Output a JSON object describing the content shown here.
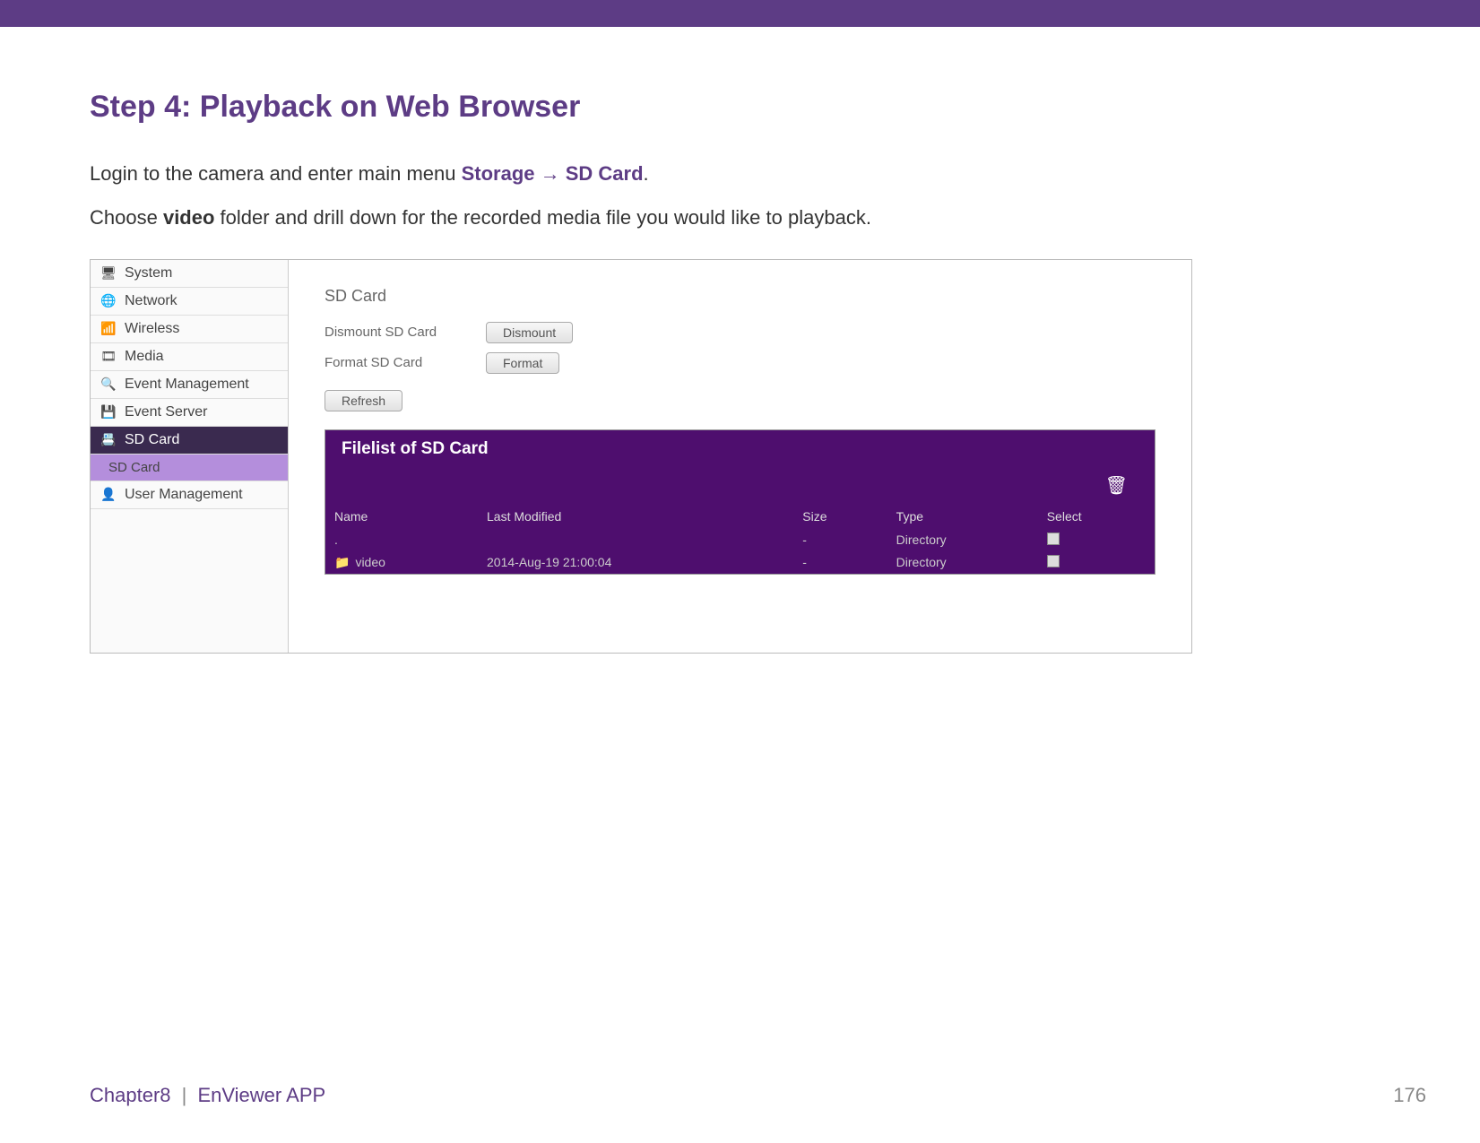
{
  "heading": "Step 4: Playback on Web Browser",
  "para1_a": "Login to the camera and enter main menu ",
  "para1_link1": "Storage",
  "para1_arrow": " → ",
  "para1_link2": "SD Card",
  "para1_end": ".",
  "para2_a": "Choose ",
  "para2_bold": "video",
  "para2_b": " folder and drill down for the recorded media file you would like to playback.",
  "nav": {
    "system": "System",
    "network": "Network",
    "wireless": "Wireless",
    "media": "Media",
    "event_mgmt": "Event Management",
    "event_server": "Event Server",
    "sd_card": "SD Card",
    "sd_card_sub": "SD Card",
    "user_mgmt": "User Management"
  },
  "panel": {
    "title": "SD Card",
    "dismount_label": "Dismount SD Card",
    "dismount_btn": "Dismount",
    "format_label": "Format SD Card",
    "format_btn": "Format",
    "refresh_btn": "Refresh"
  },
  "filelist": {
    "title": "Filelist of SD Card",
    "cols": {
      "name": "Name",
      "last_modified": "Last Modified",
      "size": "Size",
      "type": "Type",
      "select": "Select"
    },
    "rows": [
      {
        "name": ".",
        "last_modified": "",
        "size": "-",
        "type": "Directory"
      },
      {
        "name": "video",
        "last_modified": "2014-Aug-19 21:00:04",
        "size": "-",
        "type": "Directory"
      }
    ]
  },
  "footer": {
    "chapter": "Chapter8",
    "sep": "|",
    "app": "EnViewer APP",
    "page": "176"
  }
}
